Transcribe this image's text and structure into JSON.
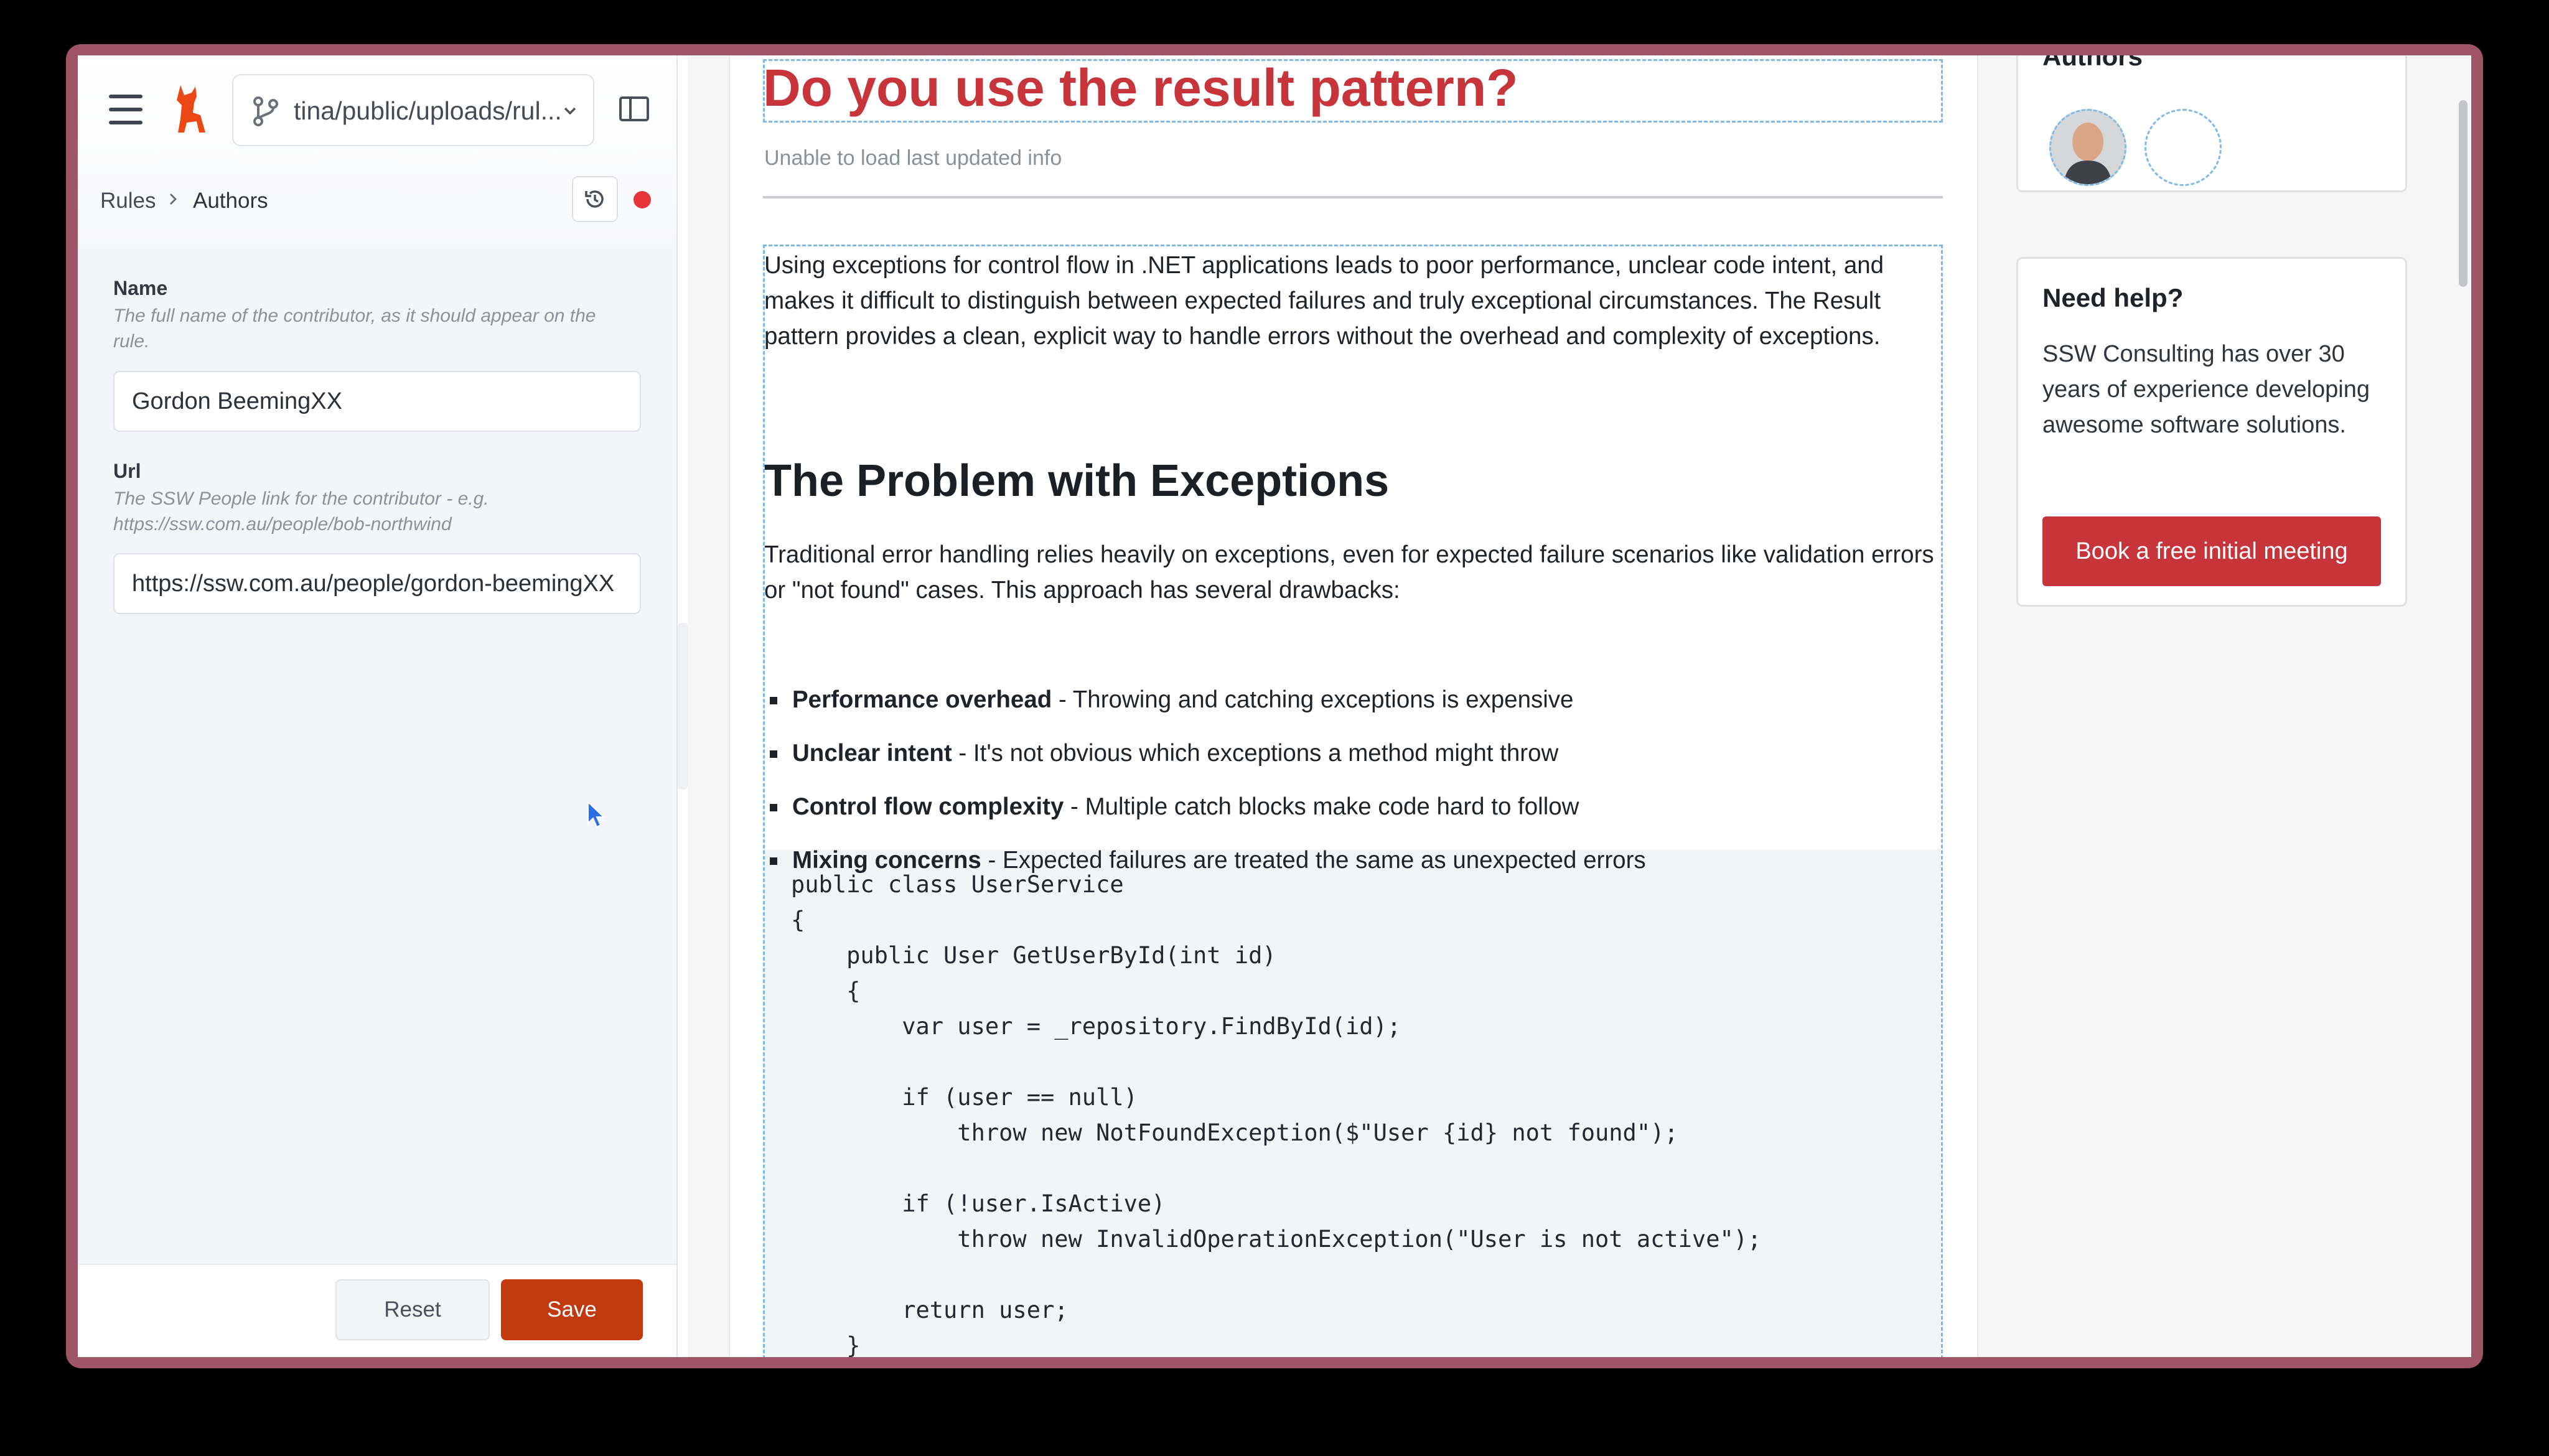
{
  "sidebar": {
    "branch": "tina/public/uploads/rul...",
    "breadcrumb": {
      "root": "Rules",
      "current": "Authors"
    },
    "fields": [
      {
        "label": "Name",
        "hint": "The full name of the contributor, as it should appear on the rule.",
        "value": "Gordon BeemingXX"
      },
      {
        "label": "Url",
        "hint": "The SSW People link for the contributor - e.g. https://ssw.com.au/people/bob-northwind",
        "value": "https://ssw.com.au/people/gordon-beemingXX"
      }
    ],
    "reset_label": "Reset",
    "save_label": "Save"
  },
  "article": {
    "title": "Do you use the result pattern?",
    "updated": "Unable to load last updated info",
    "intro": "Using exceptions for control flow in .NET applications leads to poor performance, unclear code intent, and makes it difficult to distinguish between expected failures and truly exceptional circumstances. The Result pattern provides a clean, explicit way to handle errors without the overhead and complexity of exceptions.",
    "heading": "The Problem with Exceptions",
    "para": "Traditional error handling relies heavily on exceptions, even for expected failure scenarios like validation errors or \"not found\" cases. This approach has several drawbacks:",
    "bullets": [
      {
        "bold": "Performance overhead",
        "text": " - Throwing and catching exceptions is expensive"
      },
      {
        "bold": "Unclear intent",
        "text": " - It's not obvious which exceptions a method might throw"
      },
      {
        "bold": "Control flow complexity",
        "text": " - Multiple catch blocks make code hard to follow"
      },
      {
        "bold": "Mixing concerns",
        "text": " - Expected failures are treated the same as unexpected errors"
      }
    ],
    "code": "public class UserService\n{\n    public User GetUserById(int id)\n    {\n        var user = _repository.FindById(id);\n\n        if (user == null)\n            throw new NotFoundException($\"User {id} not found\");\n\n        if (!user.IsActive)\n            throw new InvalidOperationException(\"User is not active\");\n\n        return user;\n    }"
  },
  "aside": {
    "authors_title": "Authors",
    "help_title": "Need help?",
    "help_text": "SSW Consulting has over 30 years of experience developing awesome software solutions.",
    "book_label": "Book a free initial meeting"
  },
  "colors": {
    "frame": "#9e5568",
    "accent": "#c7353a",
    "save": "#c0390f",
    "dashed": "#7fb9e6"
  }
}
